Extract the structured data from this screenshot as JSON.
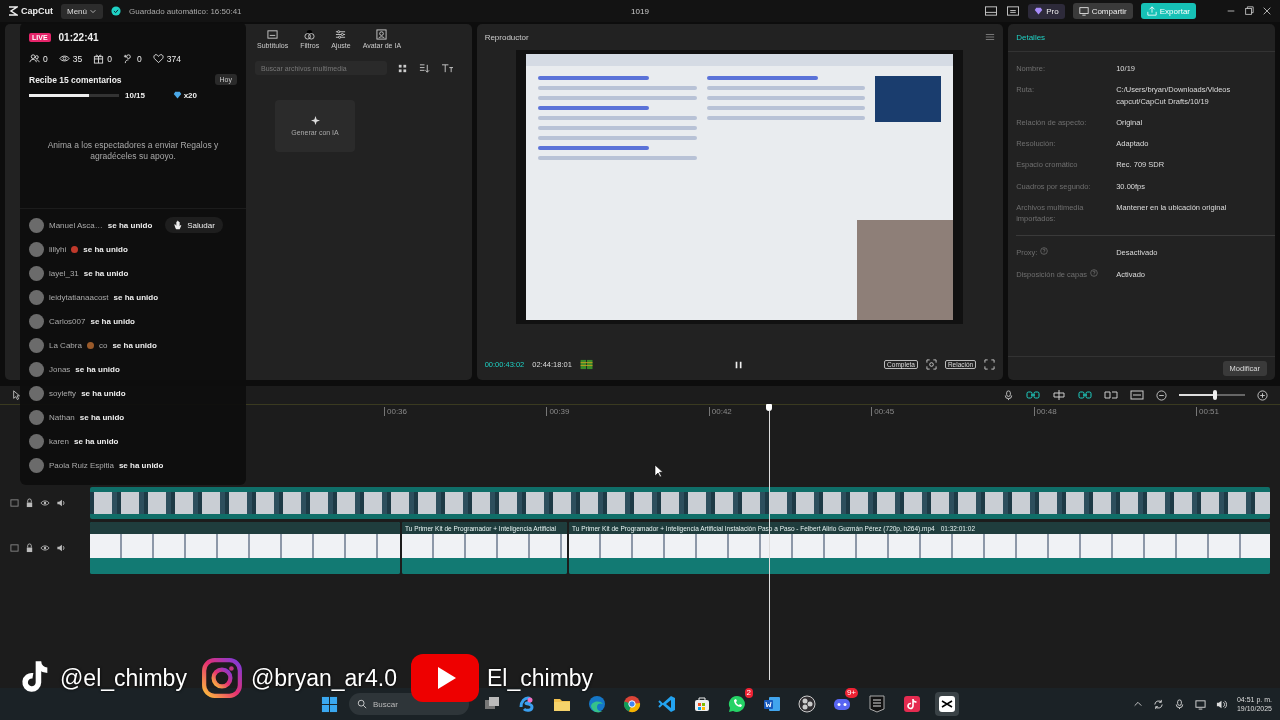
{
  "app_bar": {
    "logo": "CapCut",
    "menu": "Menú",
    "autosave": "Guardado automático: 16:50:41",
    "project_title": "1019",
    "pro": "Pro",
    "share": "Compartir",
    "export": "Exportar"
  },
  "media_panel": {
    "tabs": [
      {
        "label": "Subtítulos",
        "selected": false
      },
      {
        "label": "Filtros",
        "selected": false
      },
      {
        "label": "Ajuste",
        "selected": false
      },
      {
        "label": "Avatar de IA",
        "selected": false
      }
    ],
    "search": {
      "placeholder": "Buscar archivos multimedia"
    },
    "generate_card": "Generar con IA"
  },
  "player": {
    "title": "Reproductor",
    "current_time": "00:00:43:02",
    "duration": "02:44:18:01",
    "buttons": [
      "Completa",
      "Relación"
    ]
  },
  "details": {
    "title": "Detalles",
    "groups": [
      [
        {
          "label": "Nombre:",
          "value": "10/19",
          "help": false
        },
        {
          "label": "Ruta:",
          "value": "C:/Users/bryan/Downloads/Videos capcut/CapCut Drafts/10/19",
          "help": false
        },
        {
          "label": "Relación de aspecto:",
          "value": "Original",
          "help": false
        },
        {
          "label": "Resolución:",
          "value": "Adaptado",
          "help": false
        },
        {
          "label": "Espacio cromático",
          "value": "Rec. 709 SDR",
          "help": false
        },
        {
          "label": "Cuadros por segundo:",
          "value": "30.00fps",
          "help": false
        },
        {
          "label": "Archivos multimedia importados:",
          "value": "Mantener en la ubicación original",
          "help": false
        }
      ],
      [
        {
          "label": "Proxy:",
          "value": "Desactivado",
          "help": true
        },
        {
          "label": "Disposición de capas",
          "value": "Activado",
          "help": true
        }
      ]
    ],
    "button": "Modificar"
  },
  "timeline": {
    "ruler": [
      "00:36",
      "00:39",
      "00:42",
      "00:45",
      "00:48",
      "00:51"
    ],
    "zoom_slider": {
      "level": 0.55
    },
    "tracks": [
      {
        "kind": "overlay"
      },
      {
        "kind": "main",
        "clips": [
          {
            "title": "Tu Primer Kit de Programador + Inteligencia Artificial"
          },
          {
            "title": "Tu Primer Kit de Programador + Inteligencia Artificial  Instalación Paso a Paso - Felbert Alirio Guzmán Pérez (720p, h264).mp4",
            "duration": "01:32:01:02"
          }
        ]
      }
    ]
  },
  "live": {
    "badge": "LIVE",
    "elapsed": "01:22:41",
    "stats": [
      {
        "kind": "viewers",
        "value": "0"
      },
      {
        "kind": "views",
        "value": "35"
      },
      {
        "kind": "gifts",
        "value": "0"
      },
      {
        "kind": "follows",
        "value": "0"
      },
      {
        "kind": "likes",
        "value": "374"
      }
    ],
    "goal": {
      "title": "Recibe 15 comentarios",
      "tag": "Hoy",
      "level": 0.67,
      "progress": "10/15",
      "reward": "x20"
    },
    "hint": "Anima a los espectadores a enviar Regalos y agradéceles su apoyo.",
    "joins": [
      {
        "name": "Manuel Asca…",
        "emoji": false,
        "text": "se ha unido",
        "greet": "Saludar"
      },
      {
        "name": "lillyhi",
        "emoji": true,
        "text": "se ha unido"
      },
      {
        "name": "layel_31",
        "emoji": false,
        "text": "se ha unido"
      },
      {
        "name": "leidytatianaacost",
        "emoji": false,
        "text": "se ha unido"
      },
      {
        "name": "Carlos007",
        "emoji": false,
        "text": "se ha unido"
      },
      {
        "name": "La Cabra",
        "emoji": true,
        "suffix": "co",
        "text": "se ha unido"
      },
      {
        "name": "Jonas",
        "emoji": false,
        "text": "se ha unido"
      },
      {
        "name": "soylefty",
        "emoji": false,
        "text": "se ha unido"
      },
      {
        "name": "Nathan",
        "emoji": false,
        "text": "se ha unido"
      },
      {
        "name": "karen",
        "emoji": false,
        "text": "se ha unido"
      },
      {
        "name": "Paola Ruiz Espitia",
        "emoji": false,
        "text": "se ha unido"
      }
    ]
  },
  "socials": [
    {
      "kind": "tiktok",
      "handle": "@el_chimby"
    },
    {
      "kind": "instagram",
      "handle": "@bryan_ar4.0"
    },
    {
      "kind": "youtube",
      "handle": "El_chimby"
    }
  ],
  "taskbar": {
    "search": "Buscar",
    "apps": [
      {
        "kind": "taskview",
        "selected": false
      },
      {
        "kind": "assistant",
        "selected": false
      },
      {
        "kind": "folder",
        "selected": false
      },
      {
        "kind": "edge",
        "selected": false
      },
      {
        "kind": "chrome",
        "selected": false
      },
      {
        "kind": "code",
        "selected": false
      },
      {
        "kind": "store",
        "selected": false
      },
      {
        "kind": "chat",
        "selected": false,
        "badge": "2"
      },
      {
        "kind": "document",
        "selected": false
      },
      {
        "kind": "recorder",
        "selected": false
      },
      {
        "kind": "voice",
        "selected": false,
        "badge": "9+"
      },
      {
        "kind": "game",
        "selected": false
      },
      {
        "kind": "video",
        "selected": false
      },
      {
        "kind": "editor",
        "selected": true
      }
    ],
    "time": "04:51 p. m.",
    "date": "19/10/2025"
  }
}
